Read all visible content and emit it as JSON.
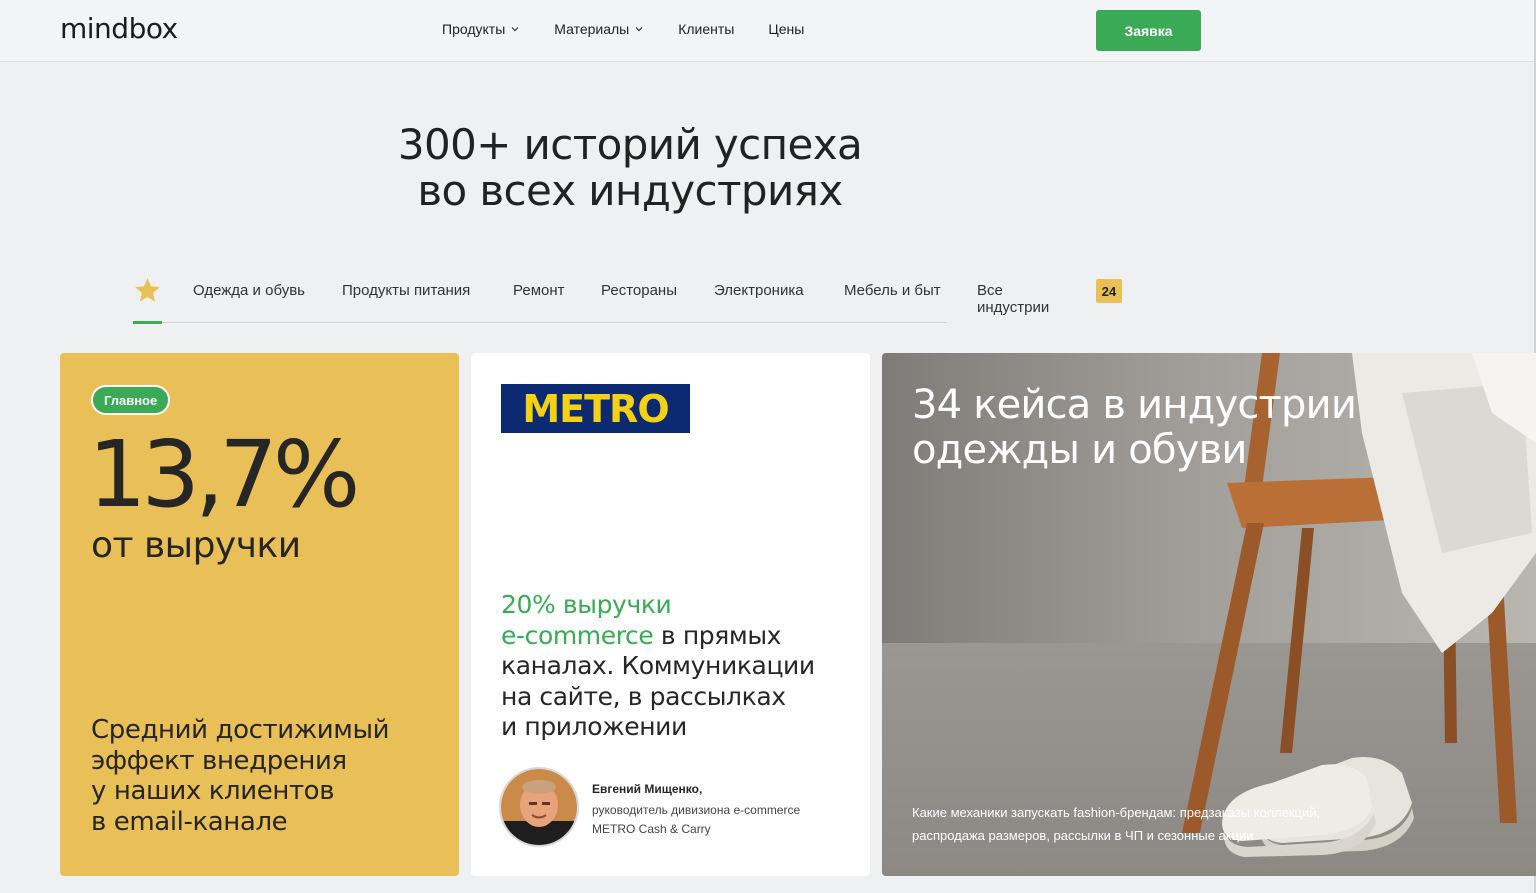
{
  "header": {
    "logo": "mindbox",
    "nav": [
      {
        "label": "Продукты",
        "has_dropdown": true
      },
      {
        "label": "Материалы",
        "has_dropdown": true
      },
      {
        "label": "Клиенты",
        "has_dropdown": false
      },
      {
        "label": "Цены",
        "has_dropdown": false
      }
    ],
    "cta_label": "Заявка"
  },
  "hero": {
    "title_line1": "300+ историй успеха",
    "title_line2": "во всех индустриях"
  },
  "tabs": {
    "items": [
      "Одежда и обувь",
      "Продукты питания",
      "Ремонт",
      "Рестораны",
      "Электроника",
      "Мебель и быт",
      "Все индустрии"
    ],
    "all_count": "24",
    "active": "star"
  },
  "cards": {
    "main": {
      "pill": "Главное",
      "value": "13,7%",
      "value_sub": "от выручки",
      "desc_lines": [
        "Средний достижимый",
        "эффект внедрения",
        "у наших клиентов",
        "в email-канале"
      ]
    },
    "metro": {
      "logo_text": "METRO",
      "quote_green_1": "20% выручки",
      "quote_green_2": "e-commerce",
      "quote_rest_1": " в прямых",
      "quote_rest_2": "каналах. Коммуникации",
      "quote_rest_3": "на сайте, в рассылках",
      "quote_rest_4": "и приложении",
      "author_name": "Евгений Мищенко,",
      "author_role_1": "руководитель дивизиона e-commerce",
      "author_role_2": "METRO Cash & Carry"
    },
    "industry": {
      "title_line1": "34 кейса в индустрии",
      "title_line2": "одежды и обуви",
      "desc_line1": "Какие механики запускать fashion-брендам: предзаказы коллекций,",
      "desc_line2": "распродажа размеров, рассылки в ЧП и сезонные акции"
    }
  },
  "colors": {
    "accent_green": "#3aaa57",
    "card_yellow": "#e9c058",
    "metro_blue": "#0b2a72",
    "metro_yellow": "#f4d113"
  }
}
